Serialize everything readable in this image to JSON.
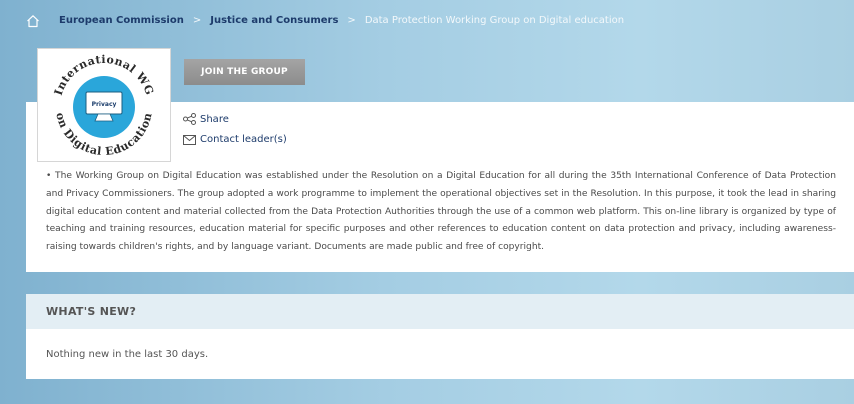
{
  "breadcrumb": {
    "home_icon": "home-icon",
    "items": [
      "European Commission",
      "Justice and Consumers"
    ],
    "separator": ">",
    "current": "Data Protection Working Group on Digital education"
  },
  "group": {
    "logo": {
      "top_text": "International WG",
      "bottom_text": "on Digital Education",
      "monitor_text": "Privacy"
    },
    "join_label": "JOIN THE GROUP",
    "share_label": "Share",
    "share_icon": "share-icon",
    "contact_label": "Contact leader(s)",
    "contact_icon": "mail-icon",
    "description": "• The Working Group on Digital Education was established under the Resolution on a Digital Education for all during the 35th International Conference of Data Protection and Privacy Commissioners. The group adopted a work programme to implement the operational objectives set in the Resolution. In this purpose, it took the lead in sharing digital education content and material collected from the Data Protection Authorities through the use of a common web platform. This on-line library is organized by type of teaching and training resources, education material for specific purposes and other references to education content on data protection and privacy, including awareness-raising towards children's rights, and by language variant. Documents are made public and free of copyright."
  },
  "whats_new": {
    "title": "WHAT'S NEW?",
    "empty_text": "Nothing new in the last 30 days."
  },
  "colors": {
    "link": "#1d3b6b",
    "logo_blue": "#2aa6da",
    "button_grey": "#999999"
  }
}
